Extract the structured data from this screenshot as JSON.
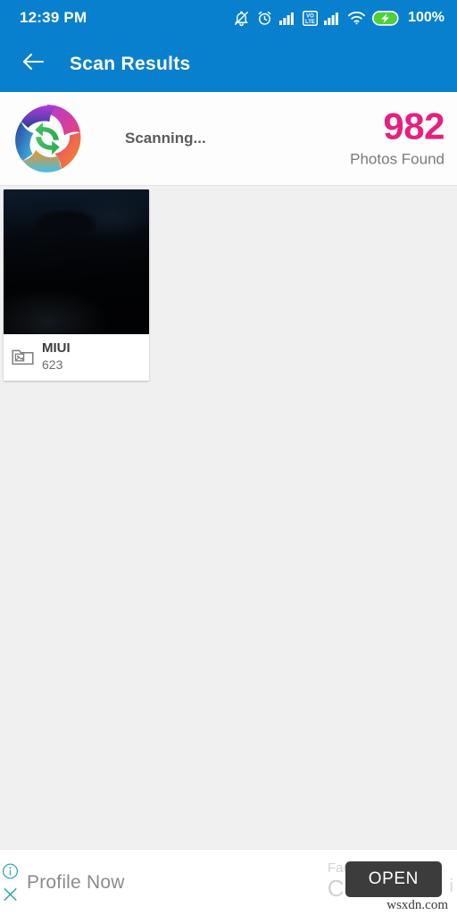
{
  "status_bar": {
    "time": "12:39 PM",
    "battery_percent": "100%",
    "icons": [
      "bell-off-icon",
      "alarm-clock-icon",
      "signal-bars-icon",
      "volte-icon",
      "signal-bars-2-icon",
      "wifi-icon",
      "battery-charging-icon"
    ],
    "volte_label_top": "VO",
    "volte_label_bottom": "LTE"
  },
  "app_bar": {
    "back_icon": "arrow-left-icon",
    "title": "Scan Results"
  },
  "summary": {
    "logo_icon": "app-refresh-logo-icon",
    "status_text": "Scanning...",
    "count": "982",
    "count_label": "Photos Found"
  },
  "results": {
    "folders": [
      {
        "name": "MIUI",
        "count": "623",
        "icon": "photo-folder-icon"
      }
    ]
  },
  "ad": {
    "info_icon": "info-circle-icon",
    "close_icon": "close-x-icon",
    "headline": "Profile Now",
    "sub_text_1": "Fac",
    "sub_text_2": "Co",
    "edge_text": "i",
    "open_label": "OPEN",
    "watermark": "wsxdn.com"
  },
  "colors": {
    "header_blue": "#0880ce",
    "accent_pink": "#e5207e",
    "content_bg": "#f0f0f0",
    "ad_teal": "#2fa8a8",
    "open_button": "#3c3c3c"
  }
}
